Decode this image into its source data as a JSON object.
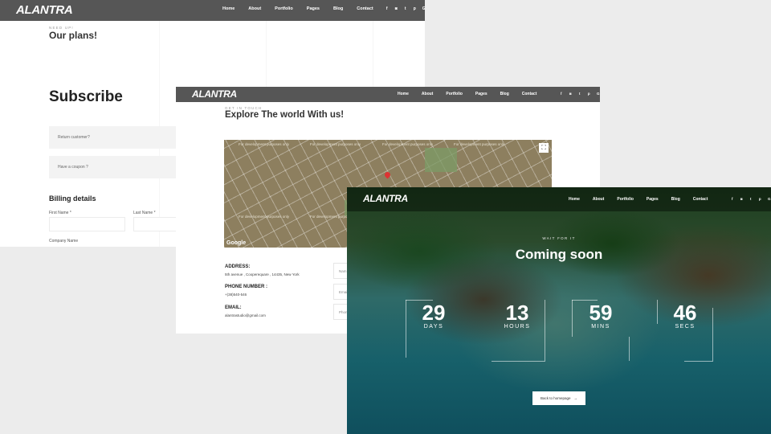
{
  "brand": "ALANTRA",
  "nav": [
    "Home",
    "About",
    "Portfolio",
    "Pages",
    "Blog",
    "Contact"
  ],
  "social": [
    "f",
    "◙",
    "t",
    "p",
    "G"
  ],
  "checkout": {
    "kicker": "NEED UP!",
    "title": "Our plans!",
    "subscribe": "Subscribe",
    "return_customer": "Return customer?",
    "coupon": "Have a coupon ?",
    "billing_title": "Billing details",
    "first_name": "First Name *",
    "last_name": "Last Name *",
    "company": "Company Name"
  },
  "contact": {
    "kicker": "GET IN TOUCH",
    "title": "Explore The world With us!",
    "map_dev_text": "For development purposes only",
    "map_google": "Google",
    "address_label": "ADDRESS:",
    "address_value": "5th avenue , Cooperequare , 14435, New York",
    "phone_label": "PHONE NUMBER :",
    "phone_value": "+(38)540-546",
    "email_label": "EMAIL:",
    "email_value": "alantrastudio@gmail.com",
    "form_fields": [
      "Nam",
      "Emai",
      "Phon"
    ]
  },
  "coming_soon": {
    "kicker": "WAIT FOR IT",
    "title": "Coming soon",
    "countdown": [
      {
        "value": "29",
        "unit": "DAYS"
      },
      {
        "value": "13",
        "unit": "HOURS"
      },
      {
        "value": "59",
        "unit": "MINS"
      },
      {
        "value": "46",
        "unit": "SECS"
      }
    ],
    "back_button": "Back to homepage",
    "back_arrow": "→"
  }
}
